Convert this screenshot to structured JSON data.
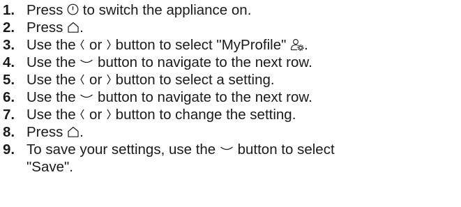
{
  "steps": [
    {
      "num": "1.",
      "pre": "Press ",
      "icon1": "power-icon",
      "post": " to switch the appliance on."
    },
    {
      "num": "2.",
      "pre": "Press ",
      "icon1": "home-icon",
      "post": "."
    },
    {
      "num": "3.",
      "pre": "Use the ",
      "icon1": "chevron-left-icon",
      "mid": " or ",
      "icon2": "chevron-right-icon",
      "post": " button to select \"MyProfile\" ",
      "icon3": "profile-settings-icon",
      "tail": "."
    },
    {
      "num": "4.",
      "pre": "Use the ",
      "icon1": "chevron-down-icon",
      "post": " button to navigate to the next row."
    },
    {
      "num": "5.",
      "pre": "Use the ",
      "icon1": "chevron-left-icon",
      "mid": " or ",
      "icon2": "chevron-right-icon",
      "post": " button to select a setting."
    },
    {
      "num": "6.",
      "pre": "Use the ",
      "icon1": "chevron-down-icon",
      "post": " button to navigate to the next row."
    },
    {
      "num": "7.",
      "pre": "Use the ",
      "icon1": "chevron-left-icon",
      "mid": " or ",
      "icon2": "chevron-right-icon",
      "post": " button to change the setting."
    },
    {
      "num": "8.",
      "pre": "Press ",
      "icon1": "home-icon",
      "post": "."
    },
    {
      "num": "9.",
      "pre": "To save your settings, use the ",
      "icon1": "chevron-down-icon",
      "post": " button to select",
      "line2": "\"Save\"."
    }
  ]
}
